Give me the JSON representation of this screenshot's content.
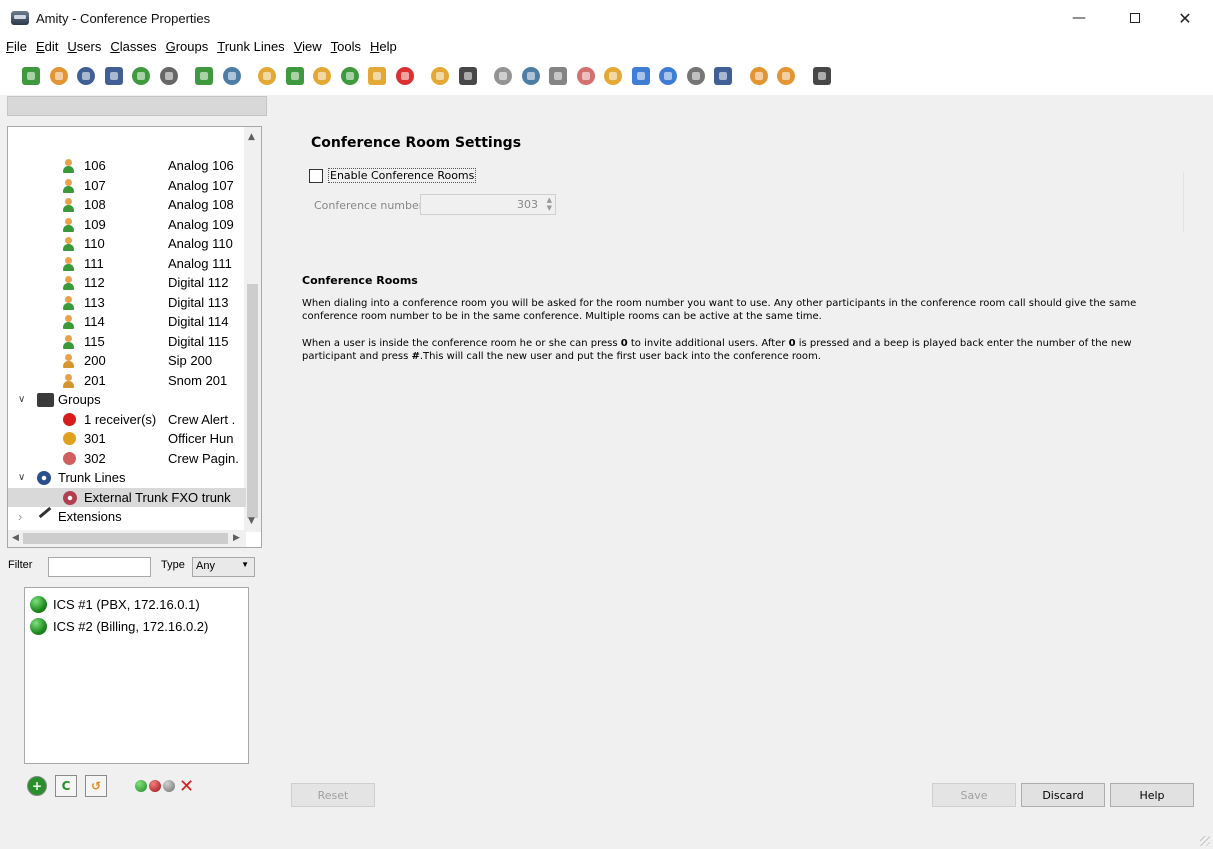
{
  "window": {
    "title": "Amity - Conference Properties",
    "min_glyph": "—",
    "close_glyph": "✕"
  },
  "menu": [
    {
      "underline": "F",
      "rest": "ile"
    },
    {
      "underline": "E",
      "rest": "dit"
    },
    {
      "underline": "U",
      "rest": "sers"
    },
    {
      "underline": "C",
      "rest": "lasses"
    },
    {
      "underline": "G",
      "rest": "roups"
    },
    {
      "underline": "T",
      "rest": "runk Lines"
    },
    {
      "underline": "V",
      "rest": "iew"
    },
    {
      "underline": "T",
      "rest": "ools"
    },
    {
      "underline": "H",
      "rest": "elp"
    }
  ],
  "toolbar_icons": [
    "new-icon",
    "open-folder-icon",
    "save-icon",
    "save-as-icon",
    "export-icon",
    "print-icon",
    "add-user-icon",
    "user-settings-icon",
    "add-group-icon",
    "call-pickup-icon",
    "hunt-group-icon",
    "paging-icon",
    "paging-2-icon",
    "alert-icon",
    "add-users-icon",
    "phonebook-icon",
    "dot-icon",
    "add-sound-icon",
    "gear-icon",
    "record-icon",
    "users-icon",
    "link-icon",
    "upload-icon",
    "tools-icon",
    "trunk-icon",
    "back-icon",
    "forward-icon",
    "server-icon"
  ],
  "tree": {
    "users": [
      {
        "num": "106",
        "name": "Analog 106",
        "type": "analog"
      },
      {
        "num": "107",
        "name": "Analog 107",
        "type": "analog"
      },
      {
        "num": "108",
        "name": "Analog 108",
        "type": "analog"
      },
      {
        "num": "109",
        "name": "Analog 109",
        "type": "analog"
      },
      {
        "num": "110",
        "name": "Analog 110",
        "type": "analog"
      },
      {
        "num": "111",
        "name": "Analog 111",
        "type": "analog"
      },
      {
        "num": "112",
        "name": "Digital 112",
        "type": "digital"
      },
      {
        "num": "113",
        "name": "Digital 113",
        "type": "digital"
      },
      {
        "num": "114",
        "name": "Digital 114",
        "type": "digital"
      },
      {
        "num": "115",
        "name": "Digital 115",
        "type": "digital"
      },
      {
        "num": "200",
        "name": "Sip 200",
        "type": "sip"
      },
      {
        "num": "201",
        "name": "Snom 201",
        "type": "sip"
      }
    ],
    "groups_label": "Groups",
    "groups": [
      {
        "num": "1 receiver(s)",
        "name": "Crew Alert ."
      },
      {
        "num": "301",
        "name": "Officer Hun"
      },
      {
        "num": "302",
        "name": "Crew Pagin."
      }
    ],
    "trunks_label": "Trunk Lines",
    "trunk_item": "External Trunk FXO trunk",
    "extensions_label": "Extensions"
  },
  "filter": {
    "label": "Filter",
    "value": "",
    "type_label": "Type",
    "type_value": "Any"
  },
  "servers": [
    {
      "label": "ICS #1 (PBX, 172.16.0.1)"
    },
    {
      "label": "ICS #2 (Billing, 172.16.0.2)"
    }
  ],
  "settings": {
    "title": "Conference Room Settings",
    "enable_label": "Enable Conference Rooms",
    "enabled": false,
    "conf_number_label": "Conference number",
    "conf_number_value": "303",
    "rooms_title": "Conference Rooms",
    "para1": "When dialing into a conference room you will be asked for the room number you want to use. Any other participants in the conference room call should give the same conference room number to be in the same conference. Multiple rooms can be active at the same time.",
    "para2_a": "When a user is inside the conference room he or she can press ",
    "para2_key1": "0",
    "para2_b": " to invite additional users. After ",
    "para2_key2": "0",
    "para2_c": " is pressed and a beep is played back enter the number of the new participant and press ",
    "para2_key3": "#",
    "para2_d": ".This will call the new user and put the first user back into the conference room."
  },
  "buttons": {
    "reset": "Reset",
    "save": "Save",
    "discard": "Discard",
    "help": "Help"
  },
  "colors": {
    "green": "#2a8f2a",
    "red": "#d61c1c",
    "orange": "#e08a1e"
  }
}
